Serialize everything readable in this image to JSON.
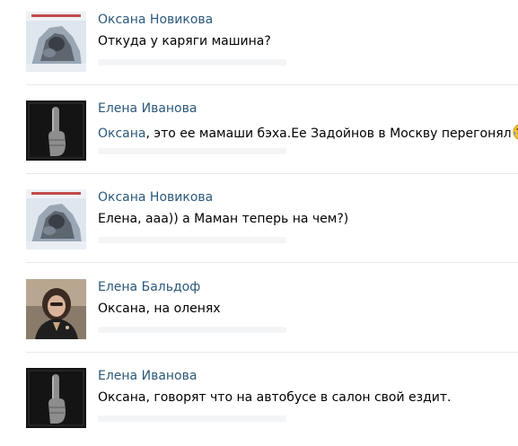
{
  "comments": [
    {
      "author": "Оксана Новикова",
      "avatar_icon": "photo-avatar-icon",
      "reply_to": "",
      "text": "Откуда у каряги машина?",
      "emoji": ""
    },
    {
      "author": "Елена Иванова",
      "avatar_icon": "middle-finger-avatar-icon",
      "reply_to": "Оксана",
      "text": ", это ее мамаши бэха.Ее Задойнов в Москву перегонял",
      "emoji": "tears-of-joy-emoji"
    },
    {
      "author": "Оксана Новикова",
      "avatar_icon": "photo-avatar-icon",
      "reply_to": "",
      "text": "Елена, ааа)) а Маман теперь на чем?)",
      "emoji": ""
    },
    {
      "author": "Елена Бальдоф",
      "avatar_icon": "woman-photo-avatar-icon",
      "reply_to": "",
      "text": "Оксана, на оленях",
      "emoji": ""
    },
    {
      "author": "Елена Иванова",
      "avatar_icon": "middle-finger-avatar-icon",
      "reply_to": "",
      "text": "Оксана, говорят что на автобусе в салон свой ездит.",
      "emoji": ""
    }
  ],
  "colors": {
    "author_link": "#2b587a",
    "text": "#000000",
    "divider": "#e6e9ed"
  }
}
